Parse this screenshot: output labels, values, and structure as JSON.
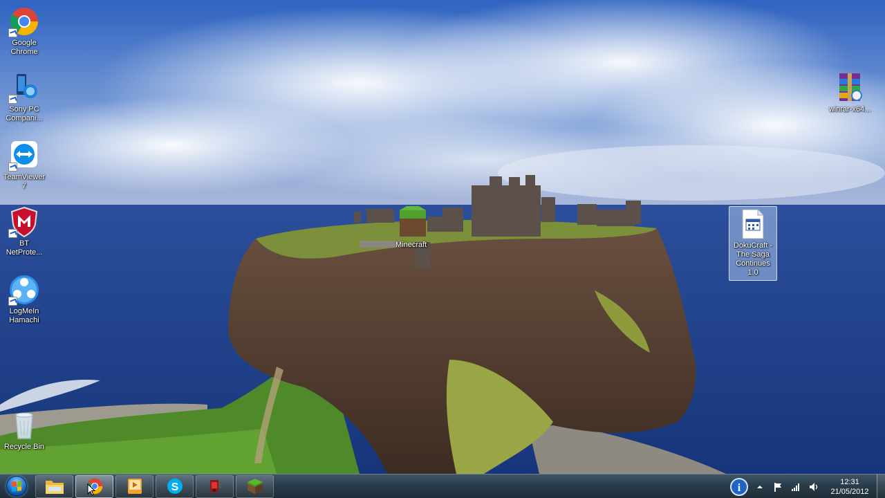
{
  "desktop": {
    "icons_left": [
      {
        "label": "Google\nChrome",
        "icon": "chrome-icon"
      },
      {
        "label": "Sony PC\nCompani...",
        "icon": "sony-pc-companion-icon"
      },
      {
        "label": "TeamViewer\n7",
        "icon": "teamviewer-icon"
      },
      {
        "label": "BT\nNetProte...",
        "icon": "mcafee-shield-icon"
      },
      {
        "label": "LogMeIn\nHamachi",
        "icon": "hamachi-icon"
      },
      {
        "label": "Recycle Bin",
        "icon": "recycle-bin-icon"
      }
    ],
    "icons_right": [
      {
        "label": "winrar-x64...",
        "icon": "winrar-archive-icon"
      },
      {
        "label": "DokuCraft -\nThe Saga\nContinues\n1.0",
        "icon": "document-file-icon"
      }
    ],
    "minecraft_label": "Minecraft"
  },
  "taskbar": {
    "start": "start-orb",
    "pinned": [
      {
        "name": "windows-explorer",
        "icon": "folder-icon"
      },
      {
        "name": "google-chrome",
        "icon": "chrome-icon",
        "active": true
      },
      {
        "name": "media-player",
        "icon": "media-player-icon"
      },
      {
        "name": "skype",
        "icon": "skype-icon"
      },
      {
        "name": "video-recorder",
        "icon": "camcorder-icon"
      },
      {
        "name": "minecraft",
        "icon": "grass-block-icon"
      }
    ],
    "tray": {
      "time": "12:31",
      "date": "21/05/2012"
    }
  },
  "colors": {
    "taskbar": "#2b3d4a",
    "sky": "#3c74c8",
    "sea": "#1e3f8a",
    "grass": "#5f9a2e",
    "cliff": "#5a4132"
  }
}
